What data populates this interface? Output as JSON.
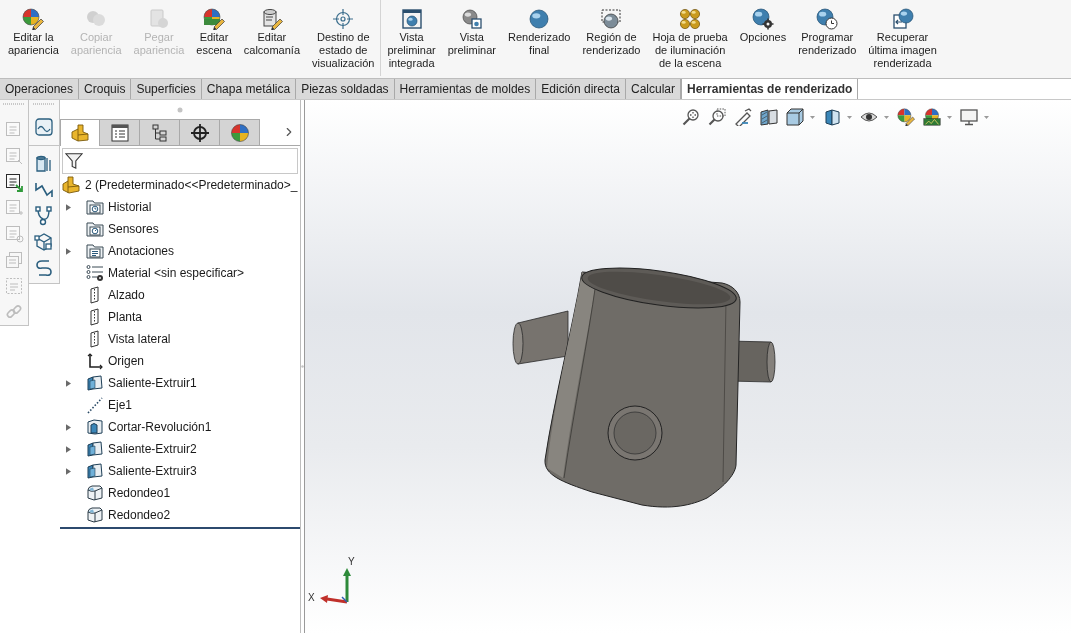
{
  "ribbon": {
    "groups": [
      [
        {
          "kind": "edit-appearance",
          "label": "Editar la\napariencia",
          "disabled": false
        },
        {
          "kind": "copy-appearance",
          "label": "Copiar\napariencia",
          "disabled": true
        },
        {
          "kind": "paste-appearance",
          "label": "Pegar\napariencia",
          "disabled": true
        },
        {
          "kind": "edit-scene",
          "label": "Editar\nescena",
          "disabled": false
        },
        {
          "kind": "edit-decal",
          "label": "Editar\ncalcomanía",
          "disabled": false
        },
        {
          "kind": "display-state-target",
          "label": "Destino de\nestado de\nvisualización",
          "disabled": false
        }
      ],
      [
        {
          "kind": "integrated-preview",
          "label": "Vista\npreliminar\nintegrada",
          "disabled": false
        },
        {
          "kind": "preview-window",
          "label": "Vista\npreliminar",
          "disabled": false
        },
        {
          "kind": "final-render",
          "label": "Renderizado\nfinal",
          "disabled": false
        },
        {
          "kind": "render-region",
          "label": "Región de\nrenderizado",
          "disabled": false
        },
        {
          "kind": "lighting-proof",
          "label": "Hoja de prueba\nde iluminación\nde la escena",
          "disabled": false
        },
        {
          "kind": "options",
          "label": "Opciones",
          "disabled": false
        },
        {
          "kind": "schedule-render",
          "label": "Programar\nrenderizado",
          "disabled": false
        },
        {
          "kind": "recall-render",
          "label": "Recuperar\núltima imagen\nrenderizada",
          "disabled": false
        }
      ]
    ]
  },
  "tabs": [
    {
      "label": "Operaciones",
      "selected": false
    },
    {
      "label": "Croquis",
      "selected": false
    },
    {
      "label": "Superficies",
      "selected": false
    },
    {
      "label": "Chapa metálica",
      "selected": false
    },
    {
      "label": "Piezas soldadas",
      "selected": false
    },
    {
      "label": "Herramientas de moldes",
      "selected": false
    },
    {
      "label": "Edición directa",
      "selected": false
    },
    {
      "label": "Calcular",
      "selected": false
    },
    {
      "label": "Herramientas de renderizado",
      "selected": true
    }
  ],
  "tool_strip": [
    {
      "kind": "note",
      "disabled": true
    },
    {
      "kind": "note-leader",
      "disabled": true
    },
    {
      "kind": "note-linked",
      "disabled": false
    },
    {
      "kind": "note-insert",
      "disabled": true
    },
    {
      "kind": "note-balloon",
      "disabled": true
    },
    {
      "kind": "stack",
      "disabled": true
    },
    {
      "kind": "frame",
      "disabled": true
    },
    {
      "kind": "chain",
      "disabled": true
    }
  ],
  "feature_manager": {
    "tabs": [
      {
        "kind": "feature-tree",
        "selected": true
      },
      {
        "kind": "property",
        "selected": false
      },
      {
        "kind": "configuration",
        "selected": false
      },
      {
        "kind": "dimxpert",
        "selected": false
      },
      {
        "kind": "display",
        "selected": false
      }
    ],
    "tree": {
      "kind": "part",
      "label": "2 (Predeterminado<<Predeterminado>_",
      "children": [
        {
          "kind": "history",
          "label": "Historial",
          "expandable": true
        },
        {
          "kind": "sensors",
          "label": "Sensores",
          "expandable": false
        },
        {
          "kind": "annotations",
          "label": "Anotaciones",
          "expandable": true
        },
        {
          "kind": "material",
          "label": "Material <sin especificar>",
          "expandable": false
        },
        {
          "kind": "plane",
          "label": "Alzado",
          "expandable": false
        },
        {
          "kind": "plane",
          "label": "Planta",
          "expandable": false
        },
        {
          "kind": "plane",
          "label": "Vista lateral",
          "expandable": false
        },
        {
          "kind": "origin",
          "label": "Origen",
          "expandable": false
        },
        {
          "kind": "extrude",
          "label": "Saliente-Extruir1",
          "expandable": true
        },
        {
          "kind": "axis",
          "label": "Eje1",
          "expandable": false
        },
        {
          "kind": "revolve-cut",
          "label": "Cortar-Revolución1",
          "expandable": true
        },
        {
          "kind": "extrude",
          "label": "Saliente-Extruir2",
          "expandable": true
        },
        {
          "kind": "extrude",
          "label": "Saliente-Extruir3",
          "expandable": true
        },
        {
          "kind": "fillet",
          "label": "Redondeo1",
          "expandable": false
        },
        {
          "kind": "fillet",
          "label": "Redondeo2",
          "expandable": false
        }
      ]
    }
  },
  "viewport": {
    "triad": {
      "x_label": "X",
      "y_label": "Y"
    }
  }
}
